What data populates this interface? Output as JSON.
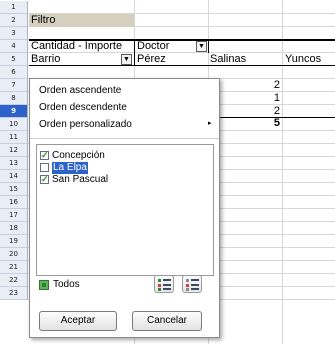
{
  "rows": [
    "1",
    "2",
    "3",
    "4",
    "5",
    "6",
    "7",
    "8",
    "9",
    "10",
    "11",
    "12",
    "13",
    "14",
    "15",
    "16",
    "17",
    "18",
    "19",
    "20",
    "21",
    "22",
    "23"
  ],
  "selected_row": "9",
  "cells": {
    "filter": "Filtro",
    "data_field": "Cantidad - Importe",
    "column_field": "Doctor",
    "row_field": "Barrio",
    "col_perez": "Pérez",
    "col_salinas": "Salinas",
    "col_yuncos": "Yuncos"
  },
  "salinas_values": [
    "2",
    "1",
    "2"
  ],
  "salinas_total": "5",
  "popup": {
    "sort_ascending": "Orden ascendente",
    "sort_descending": "Orden descendente",
    "sort_custom": "Orden personalizado",
    "submenu_arrow": "▸",
    "items": [
      {
        "label": "Concepción",
        "checked": true
      },
      {
        "label": "La Elpa",
        "checked": false
      },
      {
        "label": "San Pascual",
        "checked": true
      }
    ],
    "all_label": "Todos",
    "accept_label": "Aceptar",
    "cancel_label": "Cancelar"
  },
  "dropdown_arrow": "▼",
  "check_mark": "✓",
  "colors": {
    "selection": "#2d63c8",
    "filter_cell": "#d4cfbe",
    "check_green": "#2c8a2c"
  }
}
